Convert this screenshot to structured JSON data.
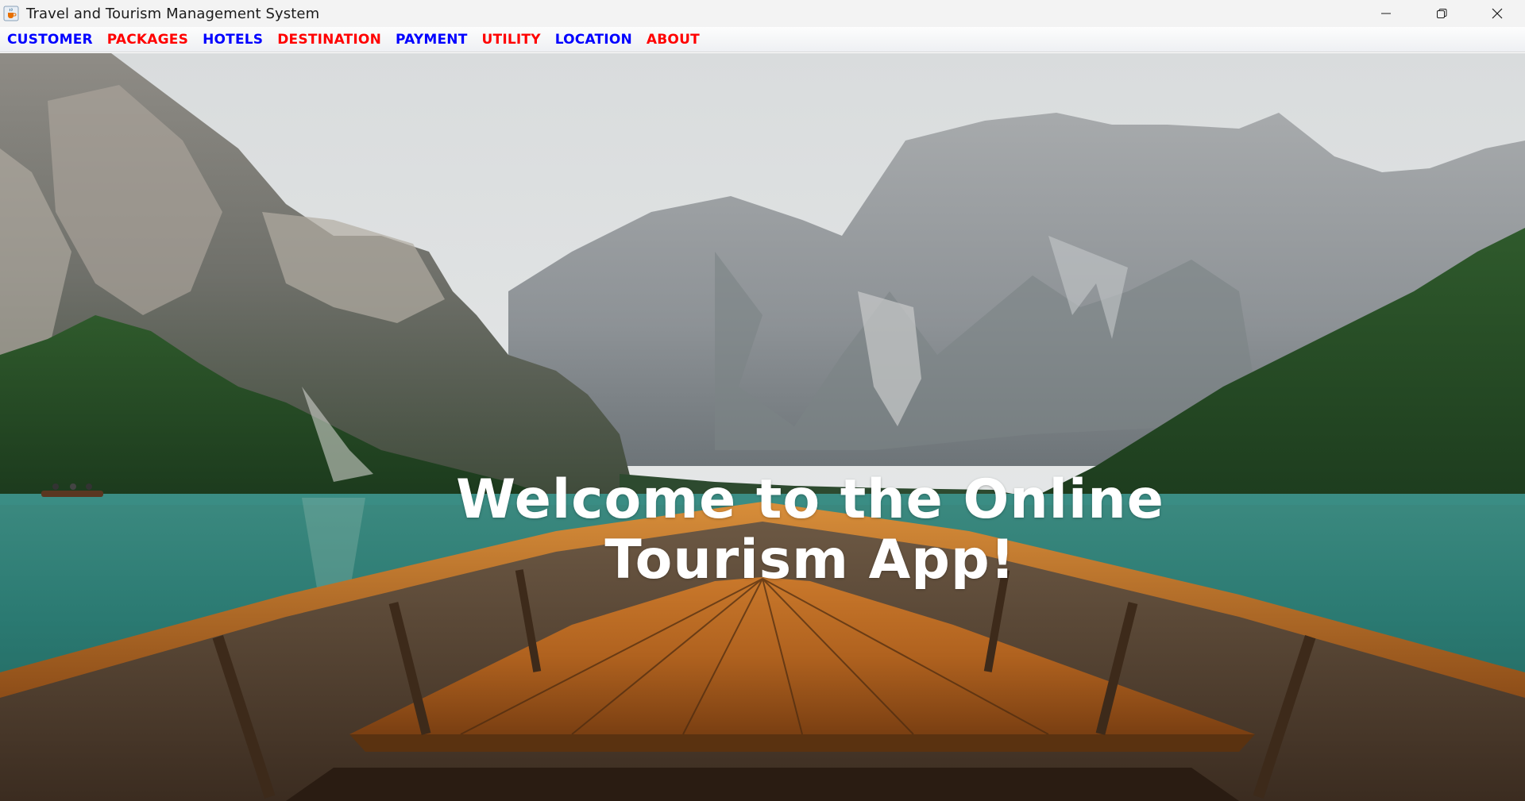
{
  "window": {
    "title": "Travel and Tourism Management System",
    "icon": "java-cup-icon"
  },
  "controls": {
    "minimize_icon": "minimize-icon",
    "restore_icon": "restore-icon",
    "close_icon": "close-icon"
  },
  "menu": {
    "items": [
      {
        "label": "CUSTOMER",
        "color": "#0000ff"
      },
      {
        "label": "PACKAGES",
        "color": "#ff0000"
      },
      {
        "label": "HOTELS",
        "color": "#0000ff"
      },
      {
        "label": "DESTINATION",
        "color": "#ff0000"
      },
      {
        "label": "PAYMENT",
        "color": "#0000ff"
      },
      {
        "label": "UTILITY",
        "color": "#ff0000"
      },
      {
        "label": "LOCATION",
        "color": "#0000ff"
      },
      {
        "label": "ABOUT",
        "color": "#ff0000"
      }
    ]
  },
  "main": {
    "welcome_line1": "Welcome to the Online",
    "welcome_line2": "Tourism App!"
  },
  "colors": {
    "menu_blue": "#0000ff",
    "menu_red": "#ff0000",
    "welcome_text": "#ffffff"
  }
}
